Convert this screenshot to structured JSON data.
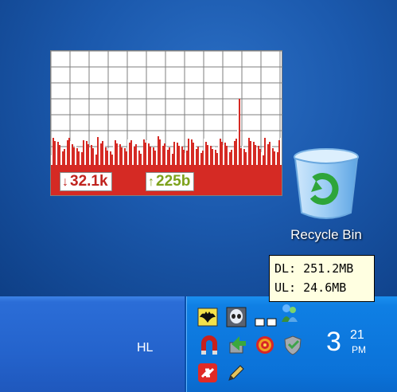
{
  "meter": {
    "download_rate": "32.1k",
    "upload_rate": "225b",
    "download_arrow": "↓",
    "upload_arrow": "↑",
    "colors": {
      "traffic_fill": "#d52a24",
      "grid": "#7f7f7f",
      "download_text": "#c0231e",
      "upload_text": "#7da21b"
    }
  },
  "desktop": {
    "recycle_bin_label": "Recycle Bin"
  },
  "tooltip": {
    "line1": "DL: 251.2MB",
    "line2": "UL: 24.6MB"
  },
  "taskbar": {
    "text": "HL",
    "clock_hour": "3",
    "clock_minutes": "21",
    "clock_ampm": "PM"
  },
  "tray_icons": [
    "batman-icon",
    "alien-icon",
    "network-meter-icon",
    "msn-messenger-icon",
    "horseshoe-magnet-icon",
    "green-arrow-icon",
    "target-icon",
    "shield-icon",
    "red-arrows-icon",
    "pencil-icon"
  ]
}
